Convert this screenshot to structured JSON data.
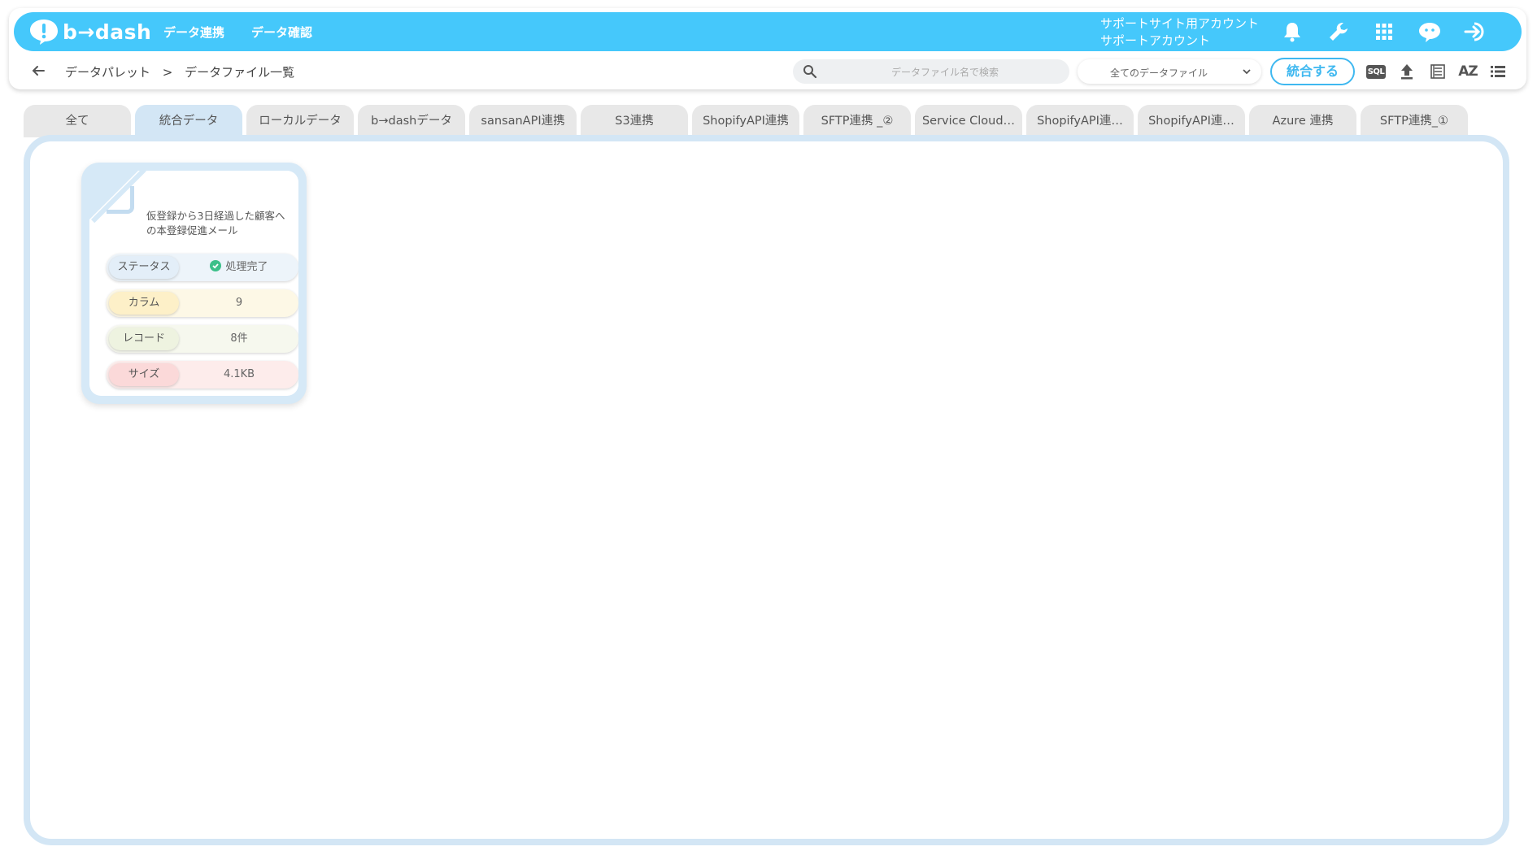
{
  "header": {
    "logo_text": "b→dash",
    "nav": [
      "データ連携",
      "データ確認"
    ],
    "account_line1": "サポートサイト用アカウント",
    "account_line2": "サポートアカウント"
  },
  "toolbar": {
    "breadcrumb": [
      "データパレット",
      ">",
      "データファイル一覧"
    ],
    "search_placeholder": "データファイル名で検索",
    "filter_selected": "全てのデータファイル",
    "merge_label": "統合する",
    "sql_label": "SQL",
    "sort_label": "AZ"
  },
  "tabs": [
    {
      "label": "全て",
      "active": false
    },
    {
      "label": "統合データ",
      "active": true
    },
    {
      "label": "ローカルデータ",
      "active": false
    },
    {
      "label": "b→dashデータ",
      "active": false
    },
    {
      "label": "sansanAPI連携",
      "active": false
    },
    {
      "label": "S3連携",
      "active": false
    },
    {
      "label": "ShopifyAPI連携",
      "active": false
    },
    {
      "label": "SFTP連携 _②",
      "active": false
    },
    {
      "label": "Service Cloud…",
      "active": false
    },
    {
      "label": "ShopifyAPI連…",
      "active": false
    },
    {
      "label": "ShopifyAPI連…",
      "active": false
    },
    {
      "label": "Azure 連携",
      "active": false
    },
    {
      "label": "SFTP連携_①",
      "active": false
    }
  ],
  "card": {
    "title": "仮登録から3日経過した顧客への本登録促進メール",
    "rows": [
      {
        "label": "ステータス",
        "value": "処理完了",
        "label_color": "#e3eef8",
        "value_color": "#edf4fa"
      },
      {
        "label": "カラム",
        "value": "9",
        "label_color": "#fdf0c8",
        "value_color": "#fdf8e6"
      },
      {
        "label": "レコード",
        "value": "8件",
        "label_color": "#eef3e0",
        "value_color": "#f6f8ee"
      },
      {
        "label": "サイズ",
        "value": "4.1KB",
        "label_color": "#fbd9d9",
        "value_color": "#fdeceb"
      }
    ]
  },
  "colors": {
    "brand": "#45c8fb",
    "accent": "#3fb8f0",
    "tab_active": "#d3e6f5",
    "status_ok": "#3cc08a"
  }
}
